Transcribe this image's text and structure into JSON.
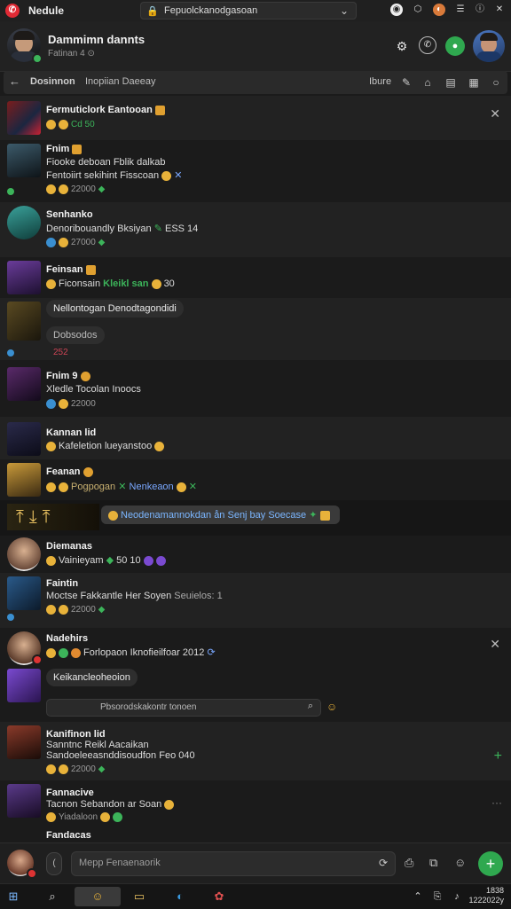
{
  "browser": {
    "title": "Nedule",
    "url": "Fepuolckanodgasoan",
    "logo_color": "#e02a35"
  },
  "header": {
    "name": "Dammimn dannts",
    "subtitle": "Fatinan 4 ⊙"
  },
  "search": {
    "query": "Dosinnon",
    "query_extra": "Inopiian Daeeay",
    "filter_label": "Ibure"
  },
  "conversations": [
    {
      "title": "Fermuticlork Eantooan",
      "line": "",
      "meta": "Cd  50"
    },
    {
      "title": "Fnim",
      "line": "Fiooke deboan Fblik dalkab",
      "line2": "Fentoiirt sekihint Fisscoan",
      "meta": "22000"
    },
    {
      "title": "Senhanko",
      "line": "Denoribouandly Bksiyan",
      "line_extra": "ESS 14",
      "meta": "27000"
    },
    {
      "title": "Feinsan",
      "line": "Ficonsain",
      "line_extra": "Kleikl san",
      "meta": "30"
    },
    {
      "title": "",
      "pill": "Nellontogan Denodtagondidi",
      "pill2": "Dobsodos",
      "meta": "252"
    },
    {
      "title": "Fnim 9",
      "line": "Xledle Tocolan Inoocs",
      "meta": "22000"
    },
    {
      "title": "Kannan lid",
      "line": "Kafeletion lueyanstoo"
    },
    {
      "title": "Feanan",
      "line": "Pogpogan",
      "line_extra": "Nenkeaon"
    },
    {
      "title": "",
      "pill": "Neodenamannokdan ån Senj bay Soecase"
    },
    {
      "title": "Diemanas",
      "line": "Vainieyam",
      "line_extra": "50 10"
    },
    {
      "title": "Faintin",
      "line": "Moctse Fakkantle Her Soyen",
      "line_extra": "Seuielos: 1",
      "meta": "22000"
    },
    {
      "title": "Nadehirs",
      "line": "Forlopaon Iknofieilfoar 2012",
      "pill": "Keikancleoheoion",
      "reply_placeholder": "Pbsorodskakontr tonoen"
    },
    {
      "title": "Kanifinon lid",
      "line": "Sanntnc Reikl Aacaikan",
      "line2": "Sandoeleeasnddisoudfon",
      "line_extra": "Feo 040",
      "meta": "22000"
    },
    {
      "title": "Fannacive",
      "line": "Tacnon Sebandon ar Soan",
      "line2": "Yiadaloon",
      "meta": ""
    },
    {
      "title": "Fandacas"
    }
  ],
  "composer": {
    "placeholder": "Mepp Fenaenaorik"
  },
  "clock": {
    "time": "1838",
    "date": "1222022y"
  }
}
